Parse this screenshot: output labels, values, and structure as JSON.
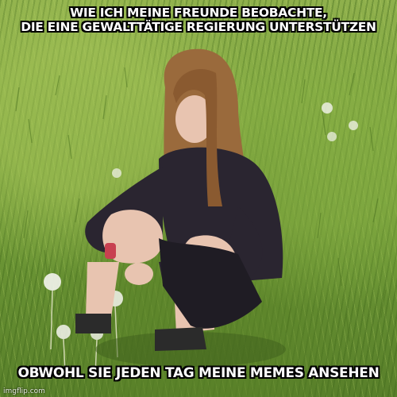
{
  "meme": {
    "top_caption": {
      "line1": "WIE ICH MEINE FREUNDE BEOBACHTE,",
      "line2": "DIE EINE GEWALTTÄTIGE REGIERUNG UNTERSTÜTZEN"
    },
    "bottom_caption": "OBWOHL SIE JEDEN TAG MEINE MEMES ANSEHEN",
    "watermark": "imgflip.com"
  },
  "colors": {
    "grass": "#6a9434",
    "hair": "#9a6a3c",
    "hoodie": "#2a2530",
    "skin": "#e8c4b0",
    "dandelion": "#f4f4ee"
  },
  "icons": {
    "girl": "girl-sitting-in-grass-illustration",
    "flowers": "dandelion-seed-heads"
  }
}
